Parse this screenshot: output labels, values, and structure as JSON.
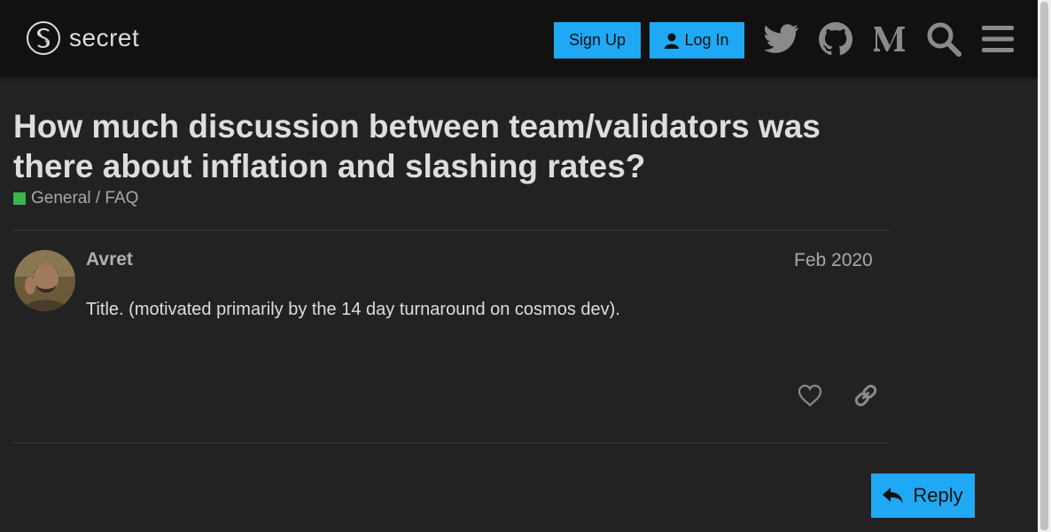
{
  "header": {
    "logo_text": "secret",
    "signup_label": "Sign Up",
    "login_label": "Log In",
    "icons": [
      "twitter-icon",
      "github-icon",
      "medium-icon",
      "search-icon",
      "hamburger-menu-icon"
    ]
  },
  "topic": {
    "title": "How much discussion between team/validators was there about inflation and slashing rates?",
    "category": "General / FAQ",
    "category_color": "#3ab54a"
  },
  "post": {
    "username": "Avret",
    "date": "Feb 2020",
    "body": "Title. (motivated primarily by the 14 day turnaround on cosmos dev).",
    "actions": [
      "heart-icon",
      "link-icon"
    ]
  },
  "footer": {
    "reply_label": "Reply"
  },
  "colors": {
    "accent": "#1fa9f4",
    "background": "#222222",
    "header_bg": "#111111",
    "text": "#dddddd"
  }
}
